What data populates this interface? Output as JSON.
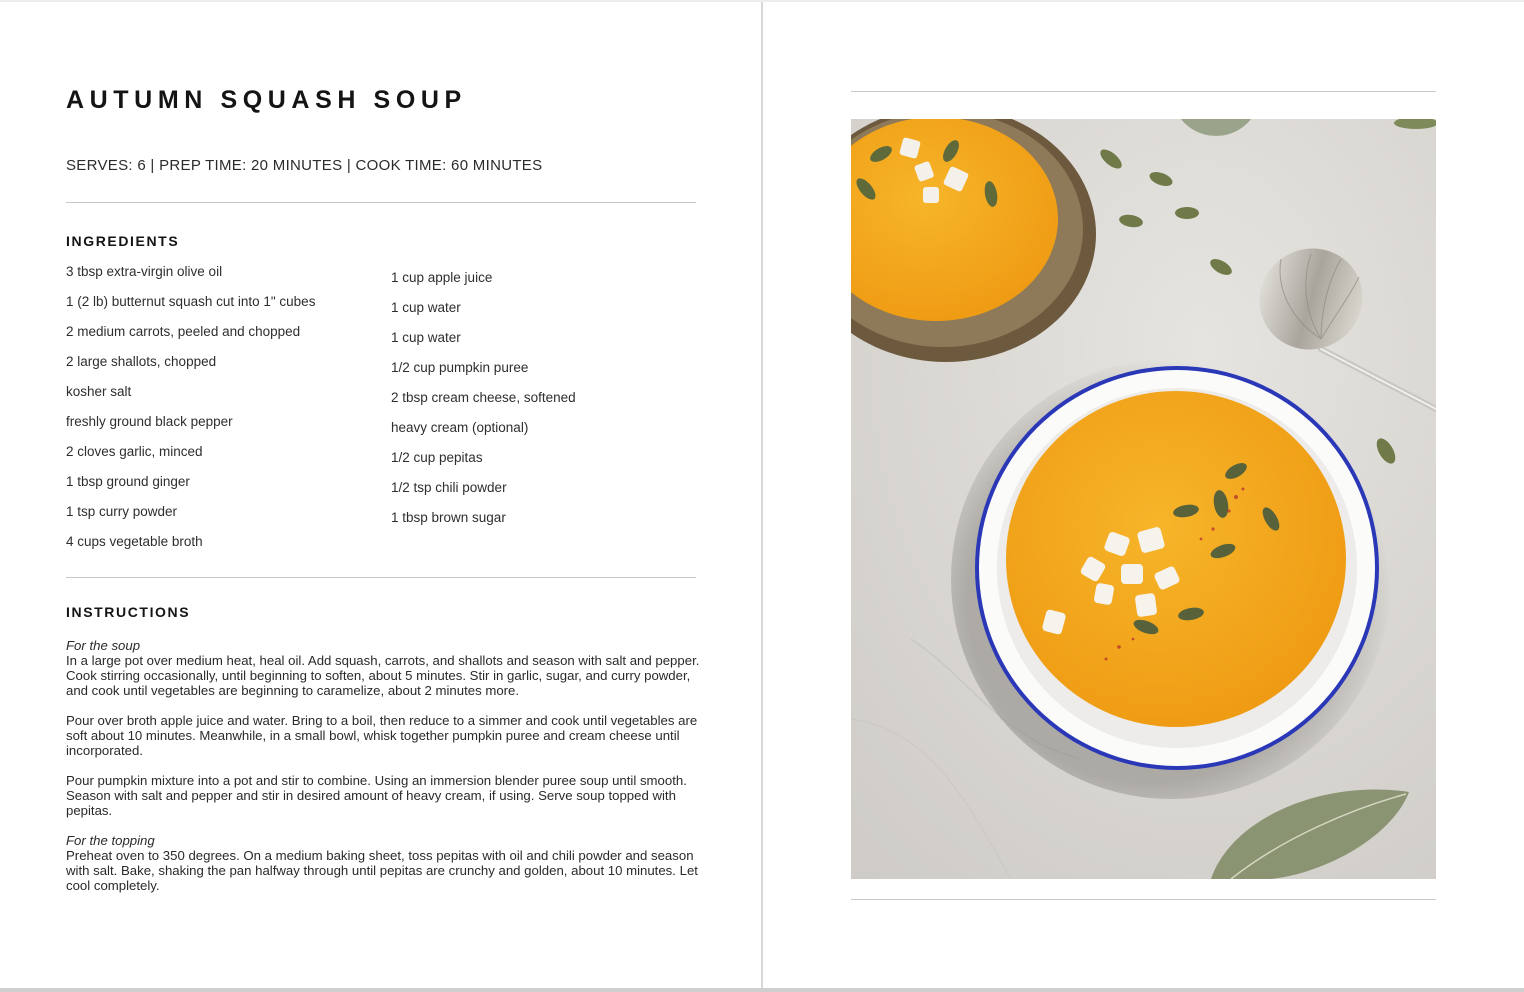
{
  "recipe": {
    "title": "AUTUMN SQUASH SOUP",
    "meta": "SERVES: 6  |  PREP TIME: 20 MINUTES  |  COOK TIME: 60 MINUTES"
  },
  "ingredients": {
    "heading": "INGREDIENTS",
    "column1": [
      "3 tbsp extra-virgin olive oil",
      "1 (2 lb) butternut squash cut into 1\" cubes",
      "2 medium carrots, peeled and chopped",
      "2 large shallots, chopped",
      "kosher salt",
      "freshly ground black pepper",
      "2 cloves garlic, minced",
      "1 tbsp ground ginger",
      "1 tsp curry powder",
      "4 cups vegetable broth"
    ],
    "column2": [
      "1 cup apple juice",
      "1 cup water",
      "1 cup water",
      "1/2 cup pumpkin puree",
      "2 tbsp cream cheese, softened",
      "heavy cream (optional)",
      "1/2 cup pepitas",
      "1/2 tsp chili powder",
      "1 tbsp brown sugar"
    ]
  },
  "instructions": {
    "heading": "INSTRUCTIONS",
    "soup_label": "For the soup",
    "soup_p1": "In a large pot over medium heat, heal oil. Add squash, carrots, and shallots and season with salt and pepper. Cook stirring occasionally, until beginning to soften, about 5 minutes. Stir in garlic, sugar, and curry powder, and cook until vegetables are beginning to caramelize, about 2 minutes more.",
    "soup_p2": "Pour over broth apple juice and water. Bring to a boil, then reduce to a simmer and cook until vegetables are soft about 10 minutes. Meanwhile, in a small bowl, whisk together pumpkin puree and cream cheese until incorporated.",
    "soup_p3": "Pour pumpkin mixture into a pot and stir to combine. Using an immersion blender puree soup until smooth. Season with salt and pepper and stir in desired amount of heavy cream, if using. Serve soup topped with pepitas.",
    "topping_label": "For the topping",
    "topping_p1": "Preheat oven to 350 degrees. On a medium baking sheet, toss pepitas with oil and chili powder and season with salt. Bake, shaking the pan halfway through until pepitas are crunchy and golden, about 10 minutes. Let cool completely."
  },
  "colors": {
    "soup": "#f2a81d",
    "bowl_rim": "#2a38b8",
    "marble": "#d9d7d3"
  }
}
